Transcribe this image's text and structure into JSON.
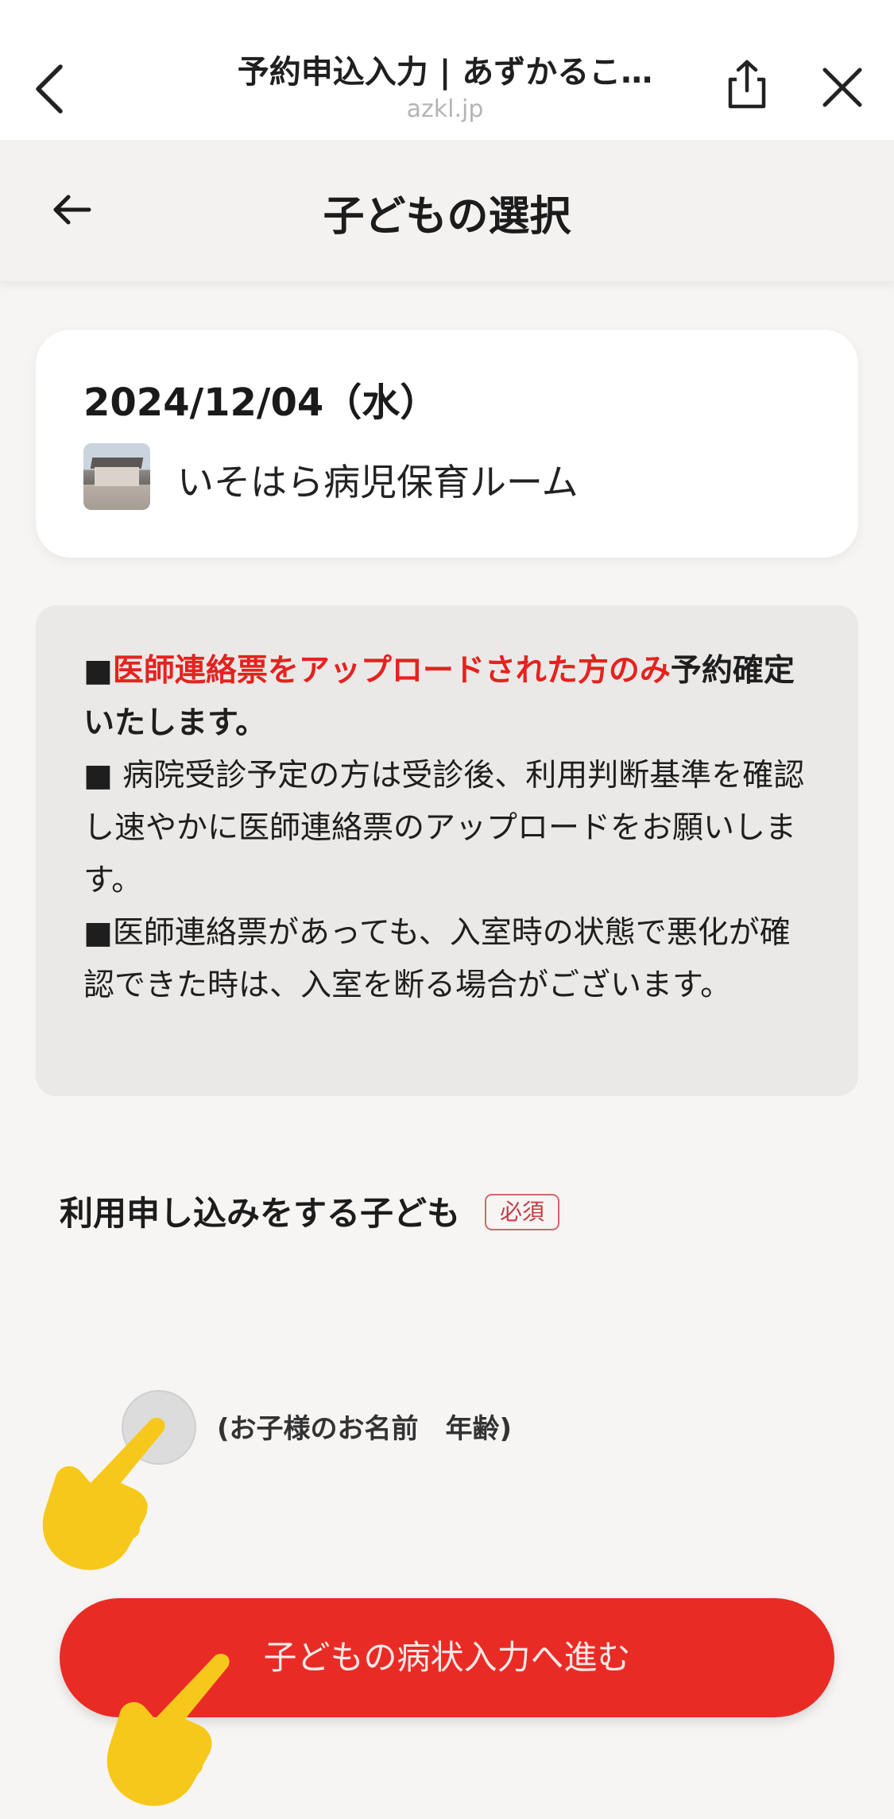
{
  "browser": {
    "title": "予約申込入力 | あずかるこ…",
    "url": "azkl.jp"
  },
  "header": {
    "title": "子どもの選択"
  },
  "reservation": {
    "date": "2024/12/04（水）",
    "facility": "いそはら病児保育ルーム"
  },
  "notice": {
    "line1_prefix": "■",
    "line1_highlight": "医師連絡票をアップロードされた方のみ",
    "line1_suffix": "予約確定いたします。",
    "line2": "■ 病院受診予定の方は受診後、利用判断基準を確認し速やかに医師連絡票のアップロードをお願いします。",
    "line3": "■医師連絡票があっても、入室時の状態で悪化が確認できた時は、入室を断る場合がございます。"
  },
  "child_select": {
    "label": "利用申し込みをする子ども",
    "required": "必須",
    "option_label": "(お子様のお名前　年齢)"
  },
  "actions": {
    "submit_label": "子どもの病状入力へ進む"
  },
  "colors": {
    "accent": "#e92b26",
    "notice_red": "#e5221f",
    "hand": "#f7c81c"
  },
  "icons": [
    "chevron-left-icon",
    "share-icon",
    "close-icon",
    "arrow-left-icon",
    "pointing-hand-icon"
  ]
}
